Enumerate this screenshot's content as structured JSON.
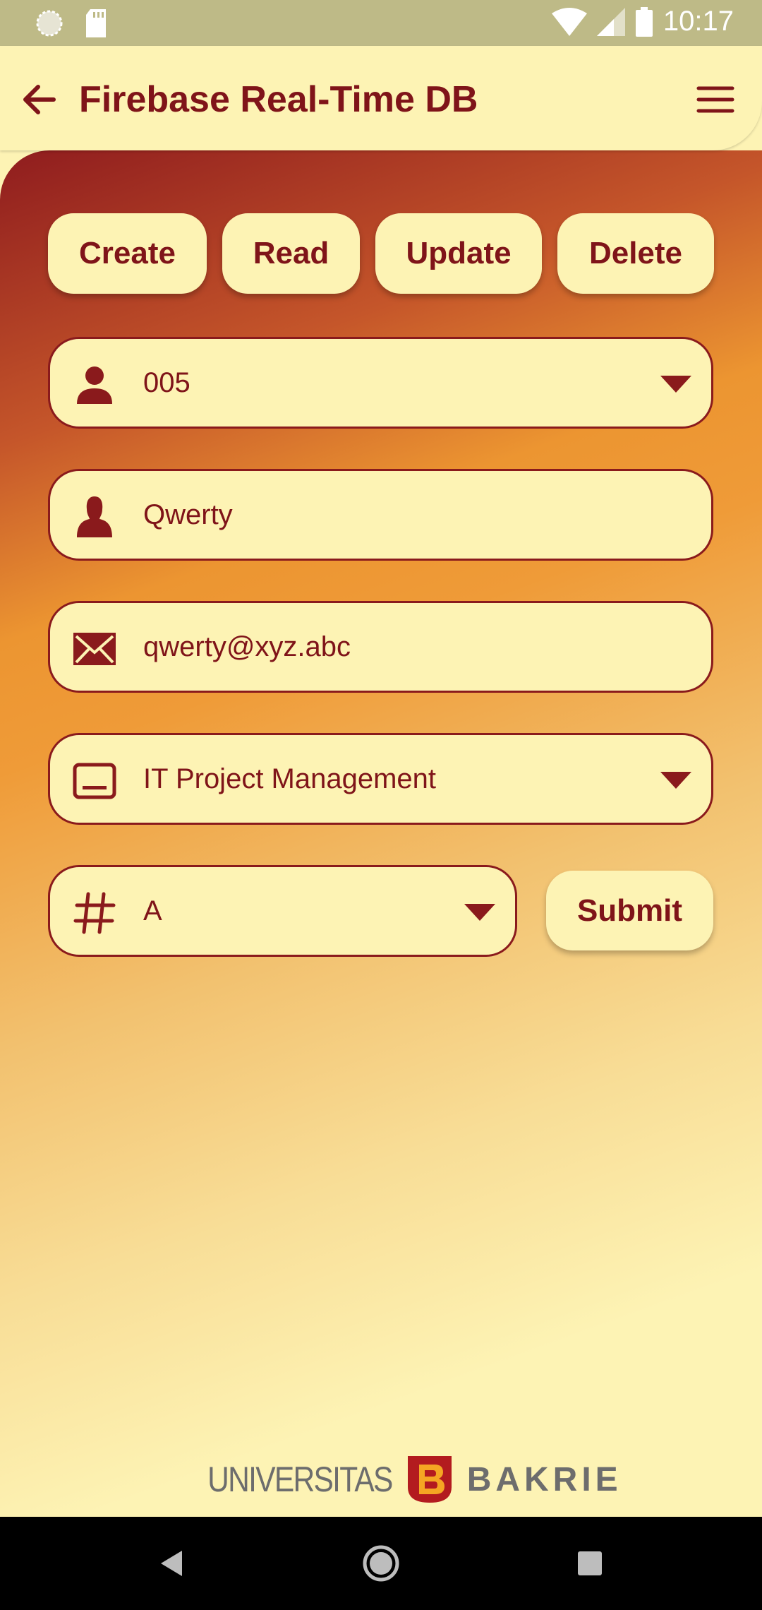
{
  "status_bar": {
    "time": "10:17",
    "icons": [
      "notification-dot-icon",
      "sd-card-icon",
      "wifi-icon",
      "signal-icon",
      "battery-icon"
    ]
  },
  "app_bar": {
    "title": "Firebase Real-Time DB",
    "back_icon": "arrow-back-icon",
    "menu_icon": "hamburger-menu-icon"
  },
  "actions": {
    "create": "Create",
    "read": "Read",
    "update": "Update",
    "delete": "Delete"
  },
  "form": {
    "id_value": "005",
    "name_value": "Qwerty",
    "email_value": "qwerty@xyz.abc",
    "course_value": "IT Project Management",
    "class_value": "A",
    "submit_label": "Submit"
  },
  "footer": {
    "brand_left": "UNIVERSITAS",
    "brand_right": "BAKRIE"
  },
  "colors": {
    "accent": "#7f1419",
    "surface": "#fdf3b4",
    "status_bar": "#beba87"
  }
}
